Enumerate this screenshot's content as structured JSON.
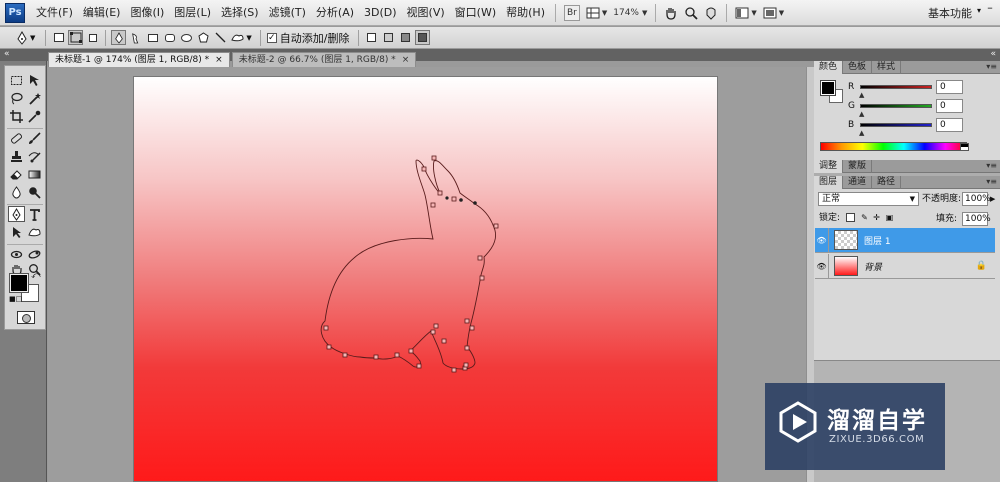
{
  "app": {
    "logo": "Ps"
  },
  "menu": [
    "文件(F)",
    "编辑(E)",
    "图像(I)",
    "图层(L)",
    "选择(S)",
    "滤镜(T)",
    "分析(A)",
    "3D(D)",
    "视图(V)",
    "窗口(W)",
    "帮助(H)"
  ],
  "menubar_tools": {
    "bridge": "Br",
    "zoom_level": "174%",
    "workspace": "基本功能",
    "workspace_arrow": "▾",
    "minimize": "–"
  },
  "options_bar": {
    "auto_add_delete_label": "自动添加/删除",
    "auto_add_checked": "✓"
  },
  "doc_tabs": [
    {
      "title": "未标题-1 @ 174% (图层 1, RGB/8) *",
      "close": "×"
    },
    {
      "title": "未标题-2 @ 66.7% (图层 1, RGB/8) *",
      "close": "×"
    }
  ],
  "panel_collapse": {
    "left": "«",
    "right": "«"
  },
  "color_panel": {
    "tabs": [
      "颜色",
      "色板",
      "样式"
    ],
    "sliders": [
      {
        "label": "R",
        "value": "0",
        "color": "#cc2222"
      },
      {
        "label": "G",
        "value": "0",
        "color": "#22aa22"
      },
      {
        "label": "B",
        "value": "0",
        "color": "#2222cc"
      }
    ]
  },
  "adjust_panel": {
    "tabs": [
      "调整",
      "蒙版"
    ]
  },
  "layers_panel": {
    "tabs": [
      "图层",
      "通道",
      "路径"
    ],
    "blend_mode": "正常",
    "opacity_label": "不透明度:",
    "opacity_value": "100%",
    "lock_label": "锁定:",
    "fill_label": "填充:",
    "fill_value": "100%",
    "layers": [
      {
        "name": "图层 1",
        "selected": true,
        "thumb": "transparent"
      },
      {
        "name": "背景",
        "selected": false,
        "thumb": "gradient",
        "locked": true
      }
    ]
  },
  "canvas": {
    "gradient_top": "#ffffff",
    "gradient_bottom": "#ff1a1a"
  },
  "watermark": {
    "title": "溜溜自学",
    "subtitle": "ZIXUE.3D66.COM"
  }
}
